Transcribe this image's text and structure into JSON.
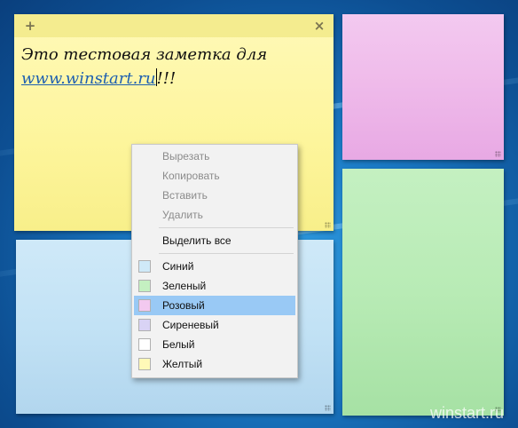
{
  "notes": {
    "yellow": {
      "add_button": "+",
      "close_button": "×",
      "text_line1": "Это тестовая заметка для",
      "text_link": "www.winstart.ru",
      "text_suffix": "!!!"
    }
  },
  "context_menu": {
    "items": [
      {
        "label": "Вырезать",
        "enabled": false
      },
      {
        "label": "Копировать",
        "enabled": false
      },
      {
        "label": "Вставить",
        "enabled": false
      },
      {
        "label": "Удалить",
        "enabled": false
      },
      {
        "label": "Выделить все",
        "enabled": true
      }
    ],
    "colors": [
      {
        "label": "Синий",
        "swatch": "#cfe9f8",
        "selected": false
      },
      {
        "label": "Зеленый",
        "swatch": "#c4f0c1",
        "selected": false
      },
      {
        "label": "Розовый",
        "swatch": "#f3c9f0",
        "selected": true
      },
      {
        "label": "Сиреневый",
        "swatch": "#d9d3f5",
        "selected": false
      },
      {
        "label": "Белый",
        "swatch": "#ffffff",
        "selected": false
      },
      {
        "label": "Желтый",
        "swatch": "#fff9b8",
        "selected": false
      }
    ]
  },
  "watermark": "winstart.ru"
}
